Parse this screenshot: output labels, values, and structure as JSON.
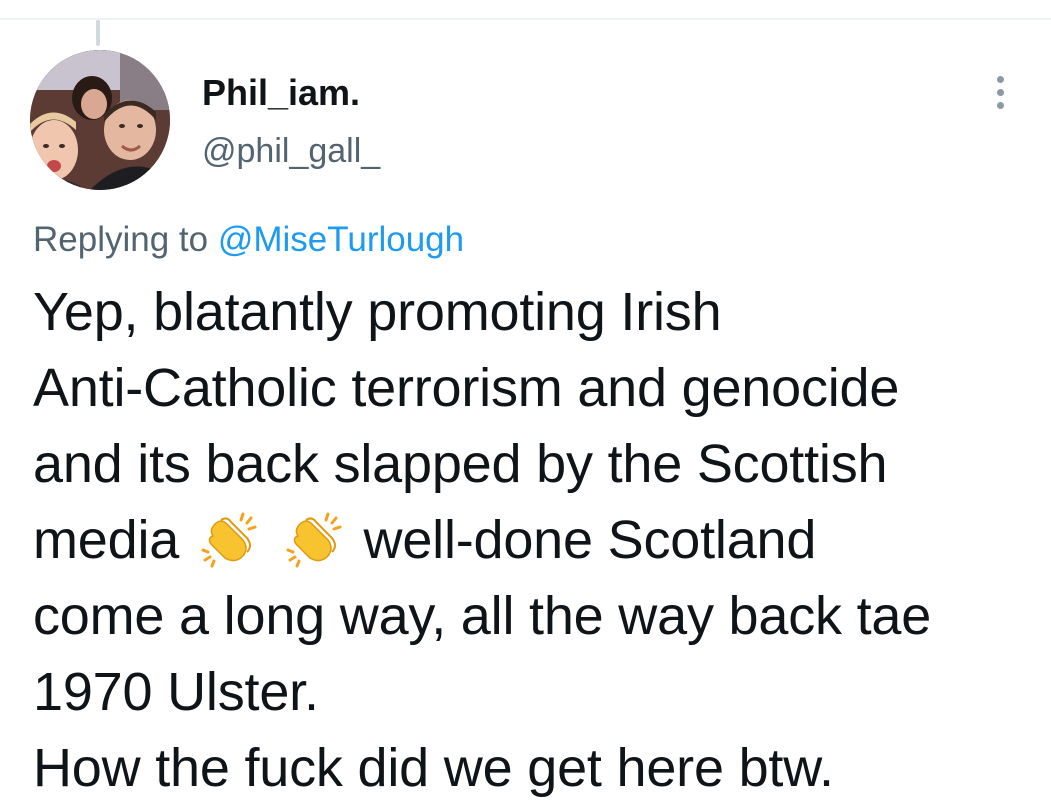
{
  "tweet": {
    "author": {
      "display_name": "Phil_iam.",
      "handle": "@phil_gall_",
      "avatar_icon": "profile-photo"
    },
    "more_icon": "more-vertical-icon",
    "reply": {
      "prefix": "Replying to",
      "handle": "@MiseTurlough"
    },
    "text": {
      "line1": "Yep, blatantly promoting Irish",
      "line2": "Anti-Catholic terrorism and genocide",
      "line3": "and its back slapped by the Scottish",
      "line4_start": "media",
      "line4_emoji": "clapping-hands-emoji",
      "line4_end": "well-done Scotland",
      "line5": "come a long way, all the way back tae",
      "line6": "1970 Ulster.",
      "line7": "How the fuck did we get here btw."
    },
    "colors": {
      "link": "#1d9bf0",
      "secondary_text": "#536471",
      "primary_text": "#0f1419"
    }
  }
}
